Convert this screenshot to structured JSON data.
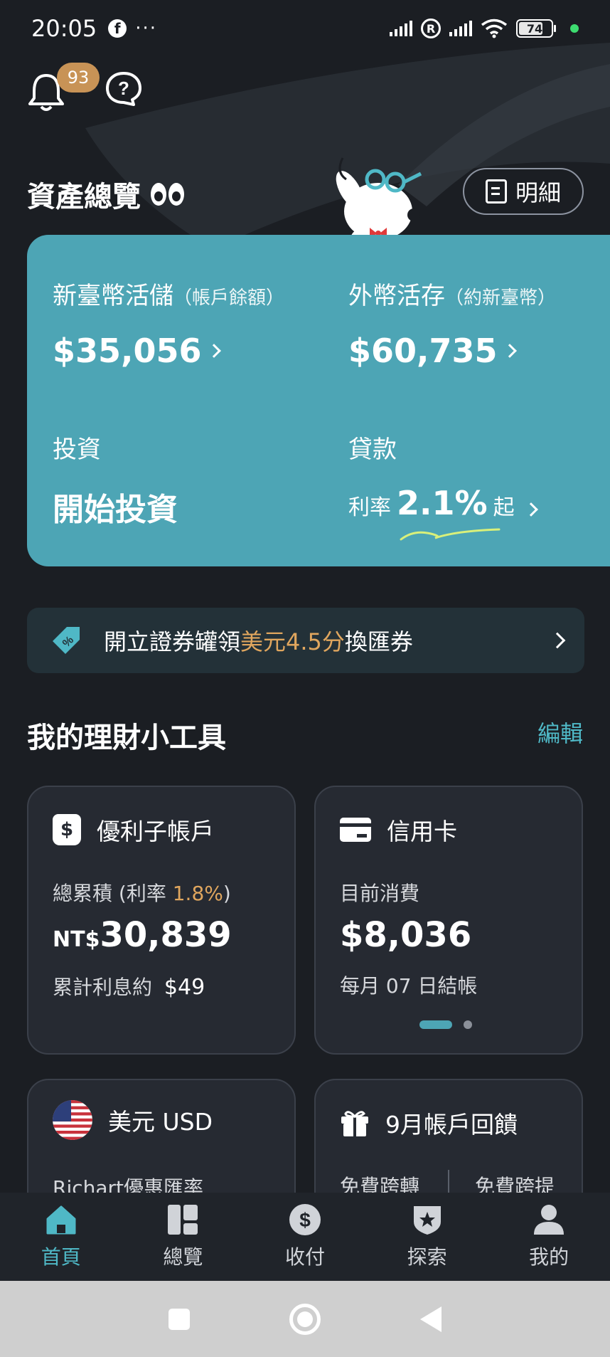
{
  "status_bar": {
    "time": "20:05",
    "dots": "···",
    "battery": "74"
  },
  "notifications": {
    "badge_count": "93"
  },
  "overview": {
    "title": "資產總覽",
    "detail_label": "明細"
  },
  "assets": {
    "twd_label": "新臺幣活儲",
    "twd_note": "（帳戶餘額）",
    "twd_value": "$35,056",
    "fx_label": "外幣活存",
    "fx_note": "（約新臺幣）",
    "fx_value": "$60,735",
    "invest_label": "投資",
    "invest_value": "開始投資",
    "loan_label": "貸款",
    "loan_rate_prefix": "利率",
    "loan_rate": "2.1%",
    "loan_rate_suffix": "起"
  },
  "promo": {
    "text_before": "開立證券罐領",
    "highlight": "美元4.5分",
    "text_after": "換匯券"
  },
  "tools": {
    "title": "我的理財小工具",
    "edit_label": "編輯",
    "savings": {
      "title": "優利子帳戶",
      "sub_prefix": "總累積 (利率 ",
      "rate": "1.8%",
      "sub_suffix": ")",
      "currency": "NT$",
      "amount": "30,839",
      "interest_label": "累計利息約",
      "interest_value": "$49"
    },
    "credit": {
      "title": "信用卡",
      "sub": "目前消費",
      "amount": "$8,036",
      "billing": "每月 07 日結帳"
    },
    "usd": {
      "title": "美元 USD",
      "sub": "Richart優惠匯率"
    },
    "rewards": {
      "title": "9月帳戶回饋",
      "left": "免費跨轉",
      "right": "免費跨提"
    }
  },
  "bottom_nav": [
    {
      "label": "首頁",
      "icon": "home-icon"
    },
    {
      "label": "總覽",
      "icon": "dashboard-icon"
    },
    {
      "label": "收付",
      "icon": "dollar-icon"
    },
    {
      "label": "探索",
      "icon": "star-shield-icon"
    },
    {
      "label": "我的",
      "icon": "person-icon"
    }
  ],
  "colors": {
    "background": "#1b1e23",
    "card_teal": "#4da5b5",
    "accent_gold": "#e0a65e",
    "badge": "#c89356",
    "nav_active": "#4fb8c6"
  }
}
